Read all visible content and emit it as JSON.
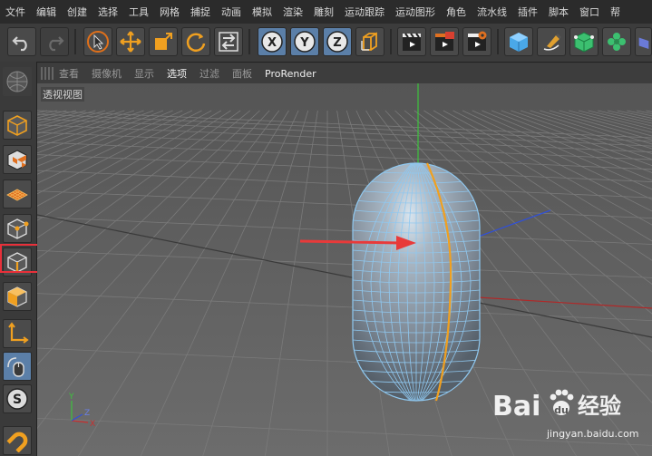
{
  "menu": [
    "文件",
    "编辑",
    "创建",
    "选择",
    "工具",
    "网格",
    "捕捉",
    "动画",
    "模拟",
    "渲染",
    "雕刻",
    "运动跟踪",
    "运动图形",
    "角色",
    "流水线",
    "插件",
    "脚本",
    "窗口",
    "帮"
  ],
  "toolbar": {
    "axis_x": "X",
    "axis_y": "Y",
    "axis_z": "Z"
  },
  "left_toolbar": {
    "snap_label": "S"
  },
  "viewport_menu": [
    "查看",
    "摄像机",
    "显示",
    "选项",
    "过滤",
    "面板",
    "ProRender"
  ],
  "viewport_menu_selected": "选项",
  "viewport": {
    "label": "透视视图",
    "axis_y": "Y",
    "axis_x": "X",
    "axis_z": "Z"
  },
  "watermark": {
    "brand": "Bai",
    "brand_cn": "经验",
    "url": "jingyan.baidu.com"
  },
  "colors": {
    "accent": "#f0a020",
    "highlight_box": "#e8303a",
    "arrow": "#e83a3a",
    "capsule_wire": "#8fc8f0"
  }
}
